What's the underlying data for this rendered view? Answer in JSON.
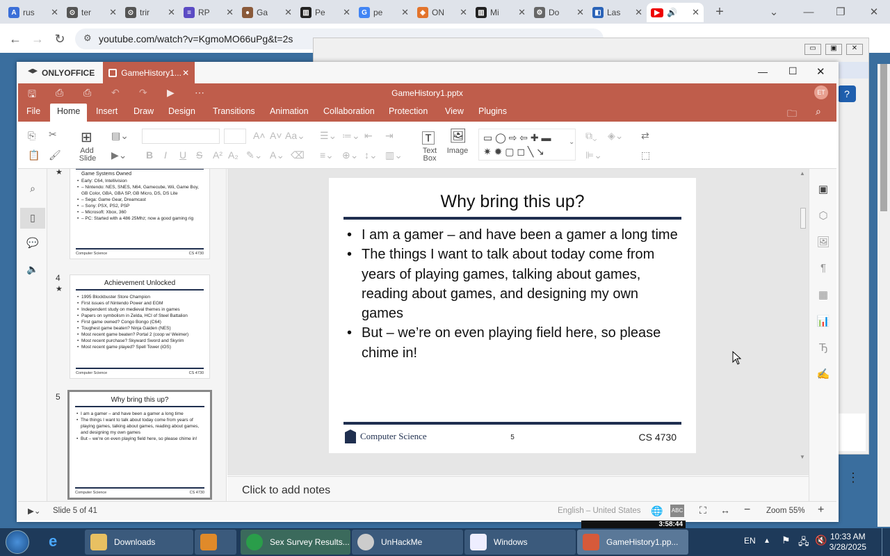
{
  "browser": {
    "tabs": [
      {
        "label": "rus",
        "color": "#3b6fd8",
        "glyph": "A"
      },
      {
        "label": "ter",
        "color": "#555",
        "glyph": "⊙"
      },
      {
        "label": "trir",
        "color": "#555",
        "glyph": "⊙"
      },
      {
        "label": "RP",
        "color": "#5b4bc4",
        "glyph": "≡"
      },
      {
        "label": "Ga",
        "color": "#8a5a3a",
        "glyph": "●"
      },
      {
        "label": "Pe",
        "color": "#222",
        "glyph": "▥"
      },
      {
        "label": "pe",
        "color": "#4285f4",
        "glyph": "G"
      },
      {
        "label": "ON",
        "color": "#e3742c",
        "glyph": "◈"
      },
      {
        "label": "Mi",
        "color": "#222",
        "glyph": "▥"
      },
      {
        "label": "Do",
        "color": "#666",
        "glyph": "⚙"
      },
      {
        "label": "Las",
        "color": "#2a63b8",
        "glyph": "◧"
      }
    ],
    "active_tab": {
      "label": "🔊",
      "color": "#e00"
    },
    "url": "youtube.com/watch?v=KgmoMO66uPg&t=2s"
  },
  "oo": {
    "brand": "ONLYOFFICE",
    "doc_tab": "GameHistory1...",
    "filename": "GameHistory1.pptx",
    "avatar": "ET",
    "menu": [
      "File",
      "Home",
      "Insert",
      "Draw",
      "Design",
      "Transitions",
      "Animation",
      "Collaboration",
      "Protection",
      "View",
      "Plugins"
    ],
    "active_menu": "Home",
    "toolbar": {
      "add_slide": "Add",
      "add_slide2": "Slide",
      "text_box": "Text",
      "text_box2": "Box",
      "image": "Image"
    }
  },
  "thumbs": {
    "t3": {
      "title": "Game Systems Owned",
      "lines": [
        "Early: C64, Intellivision",
        "– Nintendo: NES, SNES, N64, Gamecube, Wii, Game Boy, GB Color, GBA, GBA SP, GB Micro, DS, DS Lite",
        "– Sega: Game Gear, Dreamcast",
        "– Sony: PSX, PS2, PSP",
        "– Microsoft: Xbox, 360",
        "– PC: Started with a 486 25Mhz; now a good gaming rig"
      ]
    },
    "t4": {
      "num": "4",
      "title": "Achievement Unlocked",
      "lines": [
        "1995 Blockbuster Store Champion",
        "First issues of Nintendo Power and EGM",
        "Independent study on medieval themes in games",
        "Papers on symbolism in Zelda, HCI of Steel Battalion",
        "First game owned? Congo Bongo (C64)",
        "Toughest game beaten? Ninja Gaiden (NES)",
        "Most recent game beaten? Portal 2 (coop w/ Weimer)",
        "Most recent purchase? Skyward Sword and Skyrim",
        "Most recent game played? Spell Tower (iOS)"
      ]
    },
    "t5": {
      "num": "5",
      "title": "Why bring this up?",
      "lines": [
        "I am a gamer – and have been a gamer a long time",
        "The things I want to talk about today come from years of playing games, talking about games, reading about games, and designing my own games",
        "But – we're on even playing field here, so please chime in!"
      ]
    },
    "foot_left": "Computer Science",
    "foot_right": "CS 4730"
  },
  "slide": {
    "title": "Why bring this up?",
    "bullets": [
      "I am a gamer – and have been a gamer a long time",
      "The things I want to talk about today come from years of playing games, talking about games, reading about games, and designing my own games",
      "But – we’re on even playing field here, so please chime in!"
    ],
    "footer_logo": "Computer Science",
    "footer_num": "5",
    "footer_course": "CS 4730"
  },
  "notes": "Click to add notes",
  "status": {
    "slide": "Slide 5 of 41",
    "lang": "English – United States",
    "zoom": "Zoom 55%"
  },
  "video": {
    "time": "3:58:44"
  },
  "taskbar": {
    "apps": [
      "Downloads",
      "Sex Survey Results...",
      "UnHackMe",
      "Windows",
      "GameHistory1.pp..."
    ],
    "lang": "EN",
    "time": "10:33 AM",
    "date": "3/28/2025"
  }
}
